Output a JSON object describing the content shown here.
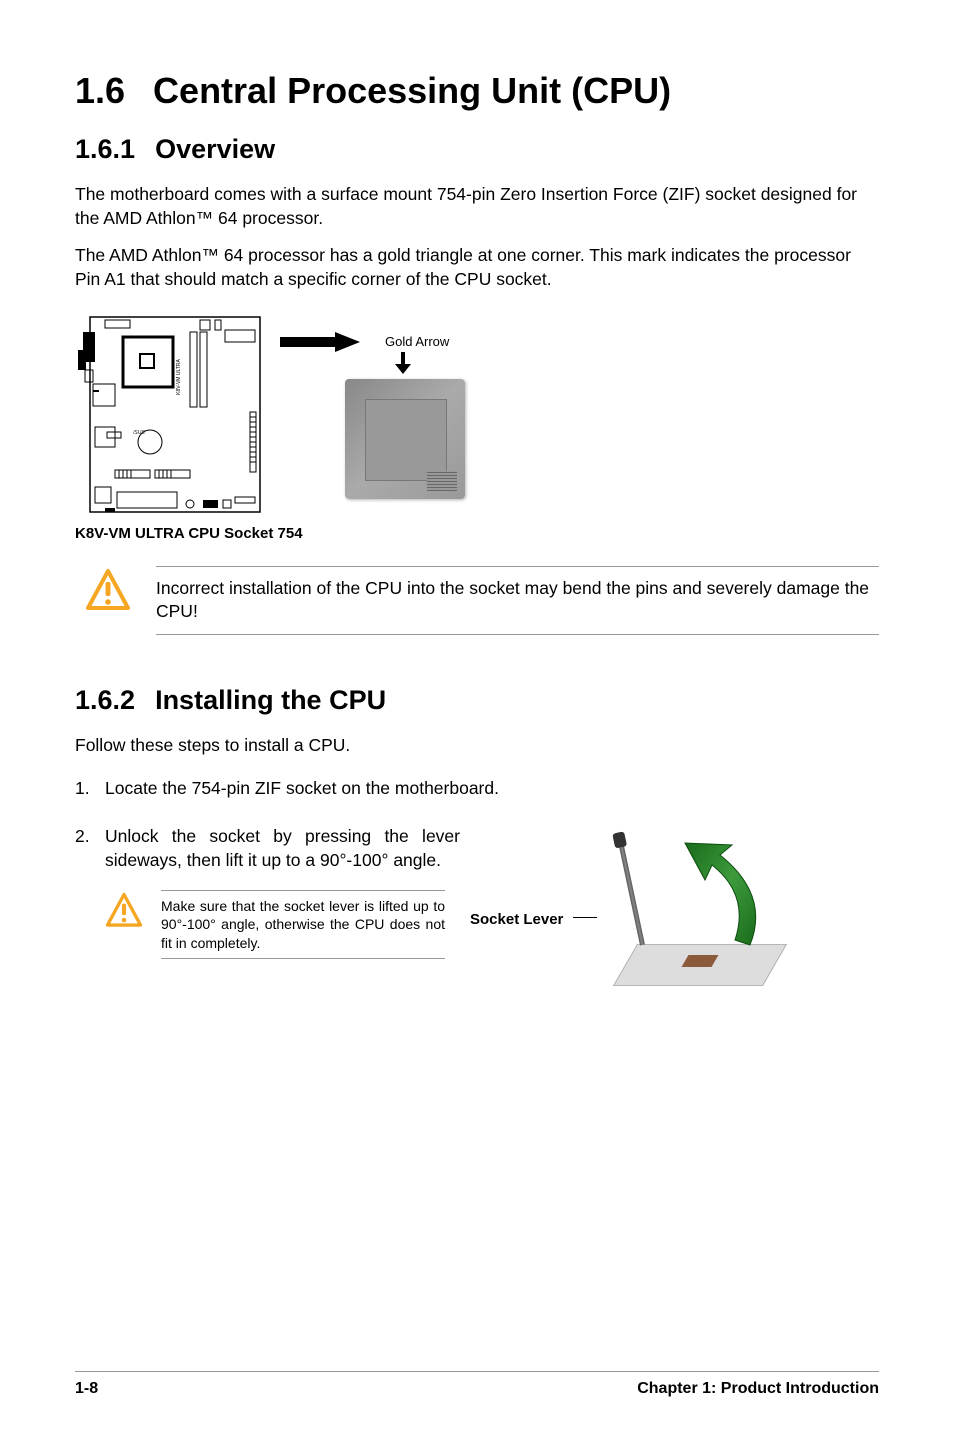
{
  "heading": {
    "number": "1.6",
    "title": "Central Processing Unit (CPU)"
  },
  "overview": {
    "number": "1.6.1",
    "title": "Overview",
    "para1": "The motherboard comes with a surface mount 754-pin Zero Insertion Force (ZIF) socket designed for the AMD Athlon™ 64 processor.",
    "para2": "The AMD Athlon™ 64 processor has a gold triangle at one corner. This mark indicates the processor Pin A1 that should match a specific corner of the CPU socket."
  },
  "figure": {
    "gold_arrow_label": "Gold Arrow",
    "caption": "K8V-VM ULTRA CPU Socket 754",
    "board_label": "K8V-VM ULTRA"
  },
  "callout1": {
    "text": "Incorrect installation of the CPU into the socket may bend the pins and severely damage the CPU!"
  },
  "install": {
    "number": "1.6.2",
    "title": "Installing the CPU",
    "intro": "Follow these steps to install a CPU.",
    "step1": "Locate the 754-pin ZIF socket on the motherboard.",
    "step2": "Unlock the socket by pressing the lever sideways, then lift it up to a 90°-100° angle.",
    "socket_lever_label": "Socket Lever",
    "callout2": "Make sure that the socket lever is lifted up to 90°-100° angle, otherwise the CPU does not fit in completely."
  },
  "footer": {
    "page": "1-8",
    "chapter": "Chapter 1: Product Introduction"
  }
}
